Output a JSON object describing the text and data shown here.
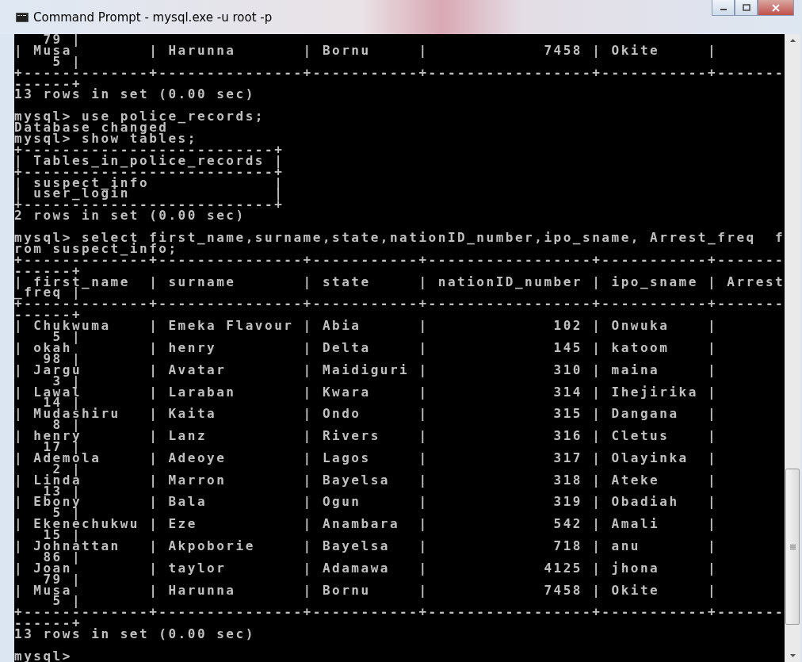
{
  "window": {
    "title": "Command Prompt - mysql.exe  -u root -p"
  },
  "console": {
    "blocks": [
      [
        "   79 |",
        "| Musa        | Harunna       | Bornu     |            7458 | Okite     |",
        "    5 |",
        "+-------------+---------------+-----------+-----------------+-----------+-------",
        "------+",
        "13 rows in set (0.00 sec)"
      ],
      [
        "mysql> use police_records;",
        "Database changed",
        "mysql> show tables;",
        "+--------------------------+",
        "| Tables_in_police_records |",
        "+--------------------------+",
        "| suspect_info             |",
        "| user_login               |",
        "+--------------------------+",
        "2 rows in set (0.00 sec)"
      ],
      [
        "mysql> select first_name,surname,state,nationID_number,ipo_sname, Arrest_freq  f",
        "rom suspect_info;",
        "+-------------+---------------+-----------+-----------------+-----------+-------",
        "------+",
        "| first_name  | surname       | state     | nationID_number | ipo_sname | Arrest",
        "_freq |",
        "+-------------+---------------+-----------+-----------------+-----------+-------",
        "------+",
        "| Chukwuma    | Emeka Flavour | Abia      |             102 | Onwuka    |",
        "    5 |",
        "| okah        | henry         | Delta     |             145 | katoom    |",
        "   98 |",
        "| Jargu       | Avatar        | Maidiguri |             310 | maina     |",
        "    3 |",
        "| Lawal       | Laraban       | Kwara     |             314 | Ihejirika |",
        "   14 |",
        "| Mudashiru   | Kaita         | Ondo      |             315 | Dangana   |",
        "    8 |",
        "| henry       | Lanz          | Rivers    |             316 | Cletus    |",
        "   17 |",
        "| Ademola     | Adeoye        | Lagos     |             317 | Olayinka  |",
        "    2 |",
        "| Linda       | Marron        | Bayelsa   |             318 | Ateke     |",
        "   13 |",
        "| Ebony       | Bala          | Ogun      |             319 | Obadiah   |",
        "    5 |",
        "| Ekenechukwu | Eze           | Anambara  |             542 | Amali     |",
        "   15 |",
        "| Johnattan   | Akpoborie     | Bayelsa   |             718 | anu       |",
        "   86 |",
        "| Joan        | taylor        | Adamawa   |            4125 | jhona     |",
        "   79 |",
        "| Musa        | Harunna       | Bornu     |            7458 | Okite     |",
        "    5 |",
        "+-------------+---------------+-----------+-----------------+-----------+-------",
        "------+",
        "13 rows in set (0.00 sec)"
      ],
      [
        "mysql>"
      ]
    ]
  }
}
